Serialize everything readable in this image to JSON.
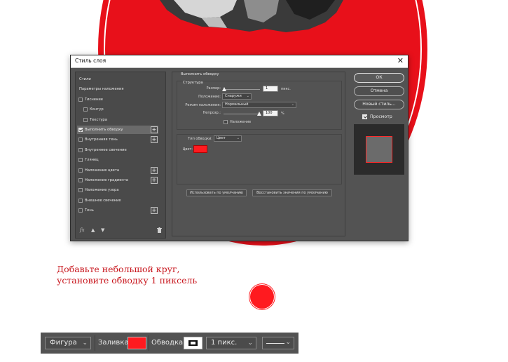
{
  "background": {
    "disc_color": "#e8101a"
  },
  "dialog": {
    "title": "Стиль слоя",
    "close_icon": "close-icon",
    "styles_list": [
      {
        "label": "Стили",
        "checkbox": false,
        "checked": false,
        "plus": false,
        "indent": 0
      },
      {
        "label": "Параметры наложения",
        "checkbox": false,
        "checked": false,
        "plus": false,
        "indent": 0
      },
      {
        "label": "Тиснение",
        "checkbox": true,
        "checked": false,
        "plus": false,
        "indent": 0
      },
      {
        "label": "Контур",
        "checkbox": true,
        "checked": false,
        "plus": false,
        "indent": 1
      },
      {
        "label": "Текстура",
        "checkbox": true,
        "checked": false,
        "plus": false,
        "indent": 1
      },
      {
        "label": "Выполнить обводку",
        "checkbox": true,
        "checked": true,
        "plus": true,
        "indent": 0,
        "active": true
      },
      {
        "label": "Внутренняя тень",
        "checkbox": true,
        "checked": false,
        "plus": true,
        "indent": 0
      },
      {
        "label": "Внутреннее свечение",
        "checkbox": true,
        "checked": false,
        "plus": false,
        "indent": 0
      },
      {
        "label": "Глянец",
        "checkbox": true,
        "checked": false,
        "plus": false,
        "indent": 0
      },
      {
        "label": "Наложение цвета",
        "checkbox": true,
        "checked": false,
        "plus": true,
        "indent": 0
      },
      {
        "label": "Наложение градиента",
        "checkbox": true,
        "checked": false,
        "plus": true,
        "indent": 0
      },
      {
        "label": "Наложение узора",
        "checkbox": true,
        "checked": false,
        "plus": false,
        "indent": 0
      },
      {
        "label": "Внешнее свечение",
        "checkbox": true,
        "checked": false,
        "plus": false,
        "indent": 0
      },
      {
        "label": "Тень",
        "checkbox": true,
        "checked": false,
        "plus": true,
        "indent": 0
      }
    ],
    "list_footer": {
      "fx_label": "fx",
      "up_icon": "arrow-up-icon",
      "down_icon": "arrow-down-icon",
      "trash_icon": "trash-icon"
    },
    "stroke": {
      "section_title": "Выполнить обводку",
      "structure_title": "Структура",
      "size_label": "Размер:",
      "size_value": "1",
      "size_unit": "пикс.",
      "position_label": "Положение:",
      "position_value": "Снаружи",
      "blend_label": "Режим наложения:",
      "blend_value": "Нормальный",
      "opacity_label": "Непрозр.:",
      "opacity_value": "100",
      "opacity_unit": "%",
      "overprint_label": "Наложение",
      "fill_type_label": "Тип обводки:",
      "fill_type_value": "Цвет",
      "color_label": "Цвет:",
      "color_value": "#ff1a1f",
      "make_default": "Использовать по умолчанию",
      "reset_default": "Восстановить значения по умолчанию"
    },
    "buttons": {
      "ok": "ОК",
      "cancel": "Отмена",
      "new_style": "Новый стиль...",
      "preview_label": "Просмотр"
    }
  },
  "caption": {
    "line1": "Добавьте небольшой круг,",
    "line2": "установите обводку 1 пиксель"
  },
  "options_bar": {
    "shape_mode": "Фигура",
    "fill_label": "Заливка:",
    "fill_color": "#ff1a1f",
    "stroke_label": "Обводка:",
    "stroke_width": "1 пикс."
  }
}
